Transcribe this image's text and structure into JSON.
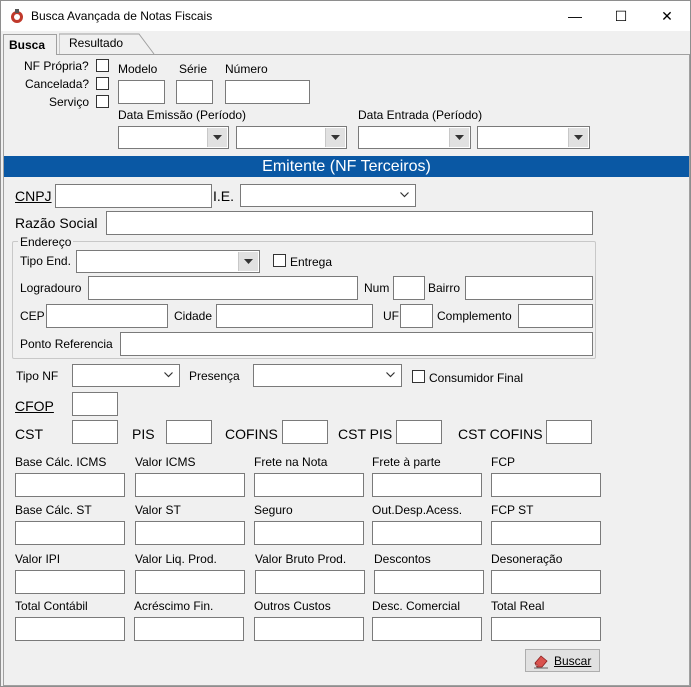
{
  "window": {
    "title": "Busca Avançada de Notas Fiscais",
    "controls": {
      "minimize": "—",
      "maximize": "☐",
      "close": "✕"
    }
  },
  "tabs": [
    {
      "label": "Busca",
      "active": true
    },
    {
      "label": "Resultado",
      "active": false
    }
  ],
  "top": {
    "nf_propria": "NF Própria?",
    "cancelada": "Cancelada?",
    "servico": "Serviço",
    "modelo": "Modelo",
    "serie": "Série",
    "numero": "Número",
    "data_emissao": "Data Emissão (Período)",
    "data_entrada": "Data Entrada (Período)"
  },
  "banner": "Emitente (NF Terceiros)",
  "emitente": {
    "cnpj": "CNPJ",
    "ie": "I.E.",
    "razao_social": "Razão Social"
  },
  "endereco": {
    "legend": "Endereço",
    "tipo_end": "Tipo End.",
    "entrega": "Entrega",
    "logradouro": "Logradouro",
    "num": "Num",
    "bairro": "Bairro",
    "cep": "CEP",
    "cidade": "Cidade",
    "uf": "UF",
    "complemento": "Complemento",
    "ponto_referencia": "Ponto Referencia"
  },
  "filters": {
    "tipo_nf": "Tipo NF",
    "presenca": "Presença",
    "consumidor_final": "Consumidor Final",
    "cfop": "CFOP",
    "cst": "CST",
    "pis": "PIS",
    "cofins": "COFINS",
    "cst_pis": "CST PIS",
    "cst_cofins": "CST COFINS"
  },
  "values": {
    "base_calc_icms": "Base Cálc. ICMS",
    "valor_icms": "Valor ICMS",
    "frete_na_nota": "Frete na Nota",
    "frete_a_parte": "Frete à parte",
    "fcp": "FCP",
    "base_calc_st": "Base Cálc. ST",
    "valor_st": "Valor ST",
    "seguro": "Seguro",
    "out_desp_acess": "Out.Desp.Acess.",
    "fcp_st": "FCP ST",
    "valor_ipi": "Valor IPI",
    "valor_liq_prod": "Valor Liq. Prod.",
    "valor_bruto_prod": "Valor Bruto Prod.",
    "descontos": "Descontos",
    "desoneracao": "Desoneração",
    "total_contabil": "Total Contábil",
    "acrescimo_fin": "Acréscimo Fin.",
    "outros_custos": "Outros Custos",
    "desc_comercial": "Desc. Comercial",
    "total_real": "Total Real"
  },
  "buscar_button": "Buscar"
}
